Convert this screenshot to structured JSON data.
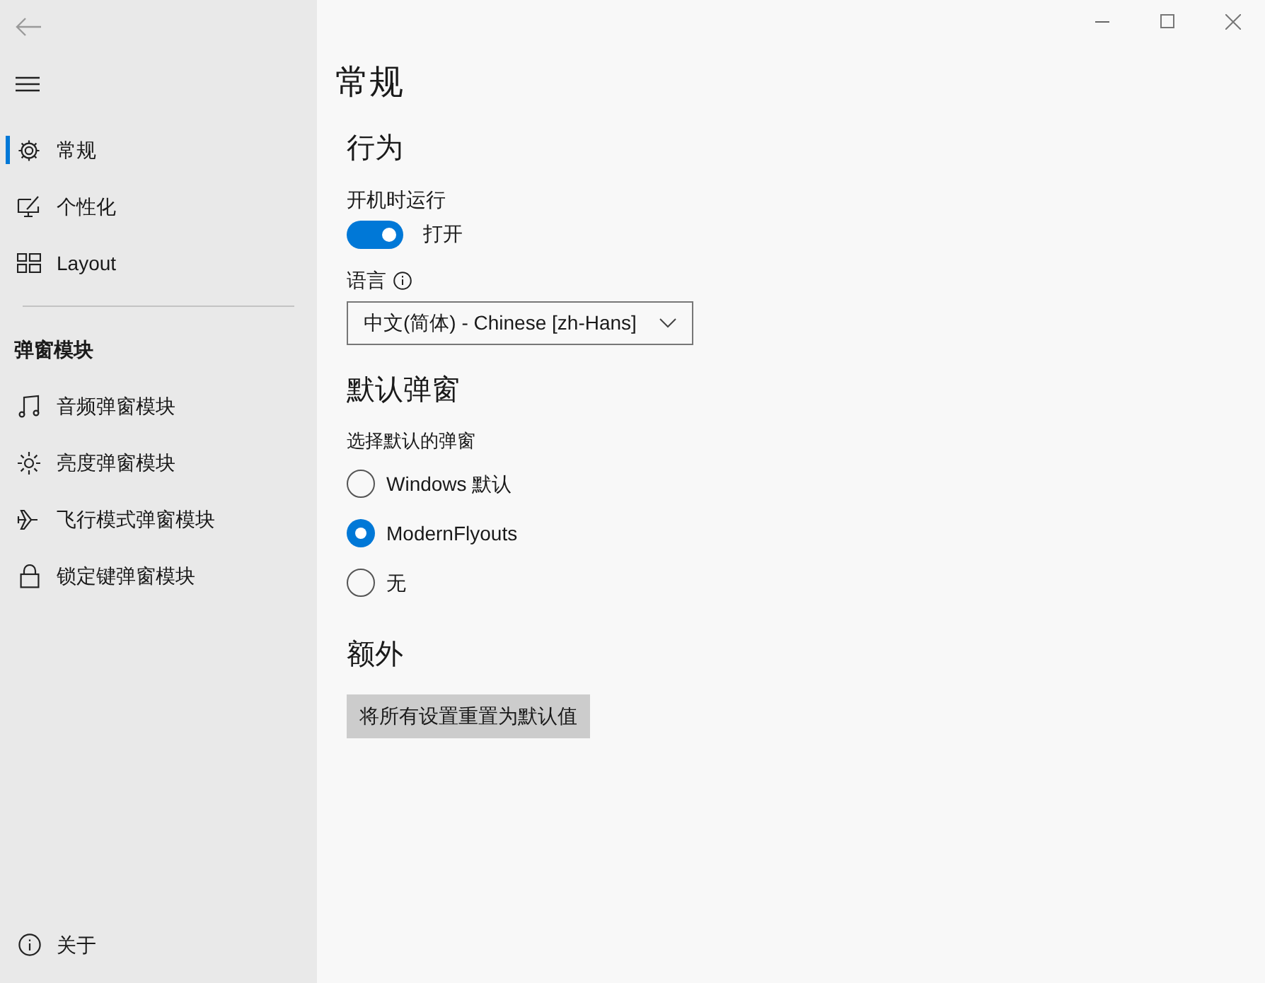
{
  "nav": {
    "items": [
      {
        "label": "常规",
        "selected": true
      },
      {
        "label": "个性化",
        "selected": false
      },
      {
        "label": "Layout",
        "selected": false
      }
    ],
    "section_title": "弹窗模块",
    "modules": [
      {
        "label": "音频弹窗模块",
        "selected": false
      },
      {
        "label": "亮度弹窗模块",
        "selected": false
      },
      {
        "label": "飞行模式弹窗模块",
        "selected": false
      },
      {
        "label": "锁定键弹窗模块",
        "selected": false
      }
    ],
    "footer": {
      "label": "关于",
      "selected": false
    }
  },
  "page_title": "常规",
  "behavior": {
    "heading": "行为",
    "startup_label": "开机时运行",
    "startup_toggle": {
      "on": true,
      "text": "打开"
    },
    "language_label": "语言",
    "language_value": "中文(简体) - Chinese [zh-Hans]"
  },
  "default_flyout": {
    "heading": "默认弹窗",
    "label": "选择默认的弹窗",
    "options": [
      {
        "label": "Windows 默认",
        "selected": false
      },
      {
        "label": "ModernFlyouts",
        "selected": true
      },
      {
        "label": "无",
        "selected": false
      }
    ]
  },
  "extra": {
    "heading": "额外",
    "reset_button": "将所有设置重置为默认值"
  }
}
